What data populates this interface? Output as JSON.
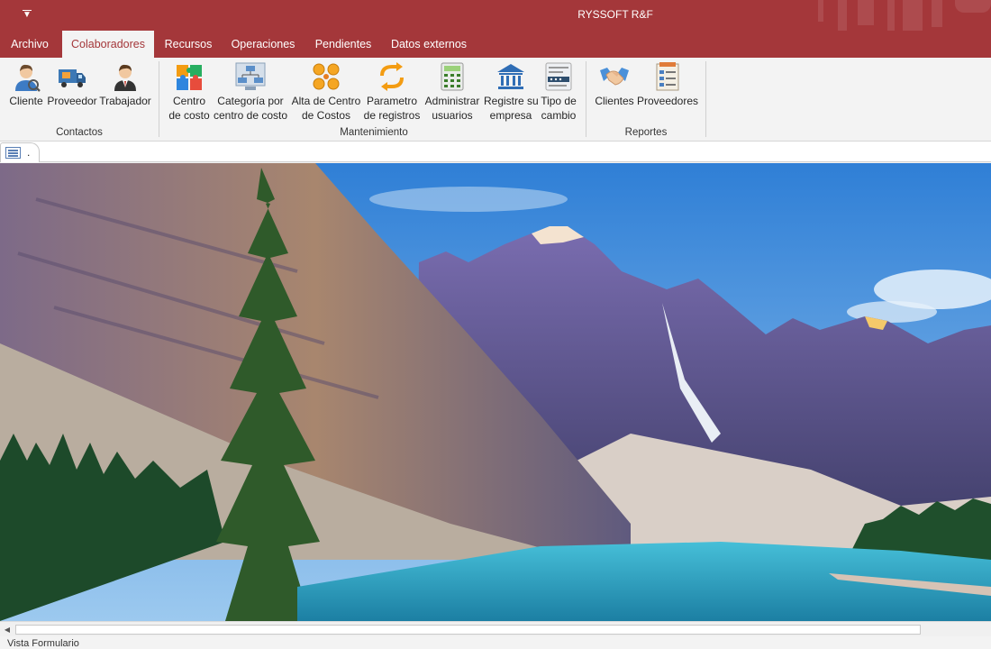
{
  "window": {
    "title": "RYSSOFT R&F",
    "qat_icon": "dropdown-arrow-icon"
  },
  "tabs": [
    "Archivo",
    "Colaboradores",
    "Recursos",
    "Operaciones",
    "Pendientes",
    "Datos externos"
  ],
  "active_tab": "Colaboradores",
  "ribbon": {
    "groups": [
      {
        "label": "Contactos",
        "buttons": [
          {
            "label": "Cliente",
            "icon": "client-person-icon"
          },
          {
            "label": "Proveedor",
            "icon": "delivery-truck-icon"
          },
          {
            "label": "Trabajador",
            "icon": "worker-person-icon"
          }
        ]
      },
      {
        "label": "Mantenimiento",
        "buttons": [
          {
            "label": "Centro\nde costo",
            "line1": "Centro",
            "line2": "de costo",
            "icon": "puzzle-icon"
          },
          {
            "label": "Categoría por centro de costo",
            "line1": "Categoría por",
            "line2": "centro de costo",
            "icon": "org-chart-icon"
          },
          {
            "label": "Alta de Centro de Costos",
            "line1": "Alta de Centro",
            "line2": "de Costos",
            "icon": "coins-icon"
          },
          {
            "label": "Parametro de registros",
            "line1": "Parametro",
            "line2": "de registros",
            "icon": "refresh-arrows-icon"
          },
          {
            "label": "Administrar usuarios",
            "line1": "Administrar",
            "line2": "usuarios",
            "icon": "calculator-icon"
          },
          {
            "label": "Registre su empresa",
            "line1": "Registre su",
            "line2": "empresa",
            "icon": "bank-building-icon"
          },
          {
            "label": "Tipo de cambio",
            "line1": "Tipo de",
            "line2": "cambio",
            "icon": "exchange-rate-icon"
          }
        ]
      },
      {
        "label": "Reportes",
        "buttons": [
          {
            "label": "Clientes",
            "icon": "handshake-icon"
          },
          {
            "label": "Proveedores",
            "icon": "document-list-icon"
          }
        ]
      }
    ]
  },
  "document_tab": {
    "label": ".",
    "icon": "form-icon"
  },
  "form": {
    "background": "mountain-lake-landscape"
  },
  "status": {
    "text": "Vista Formulario"
  },
  "colors": {
    "accent": "#a4373a",
    "ribbon_bg": "#f3f3f3",
    "sky": "#4a9ae0",
    "lake": "#2aa6c7"
  }
}
